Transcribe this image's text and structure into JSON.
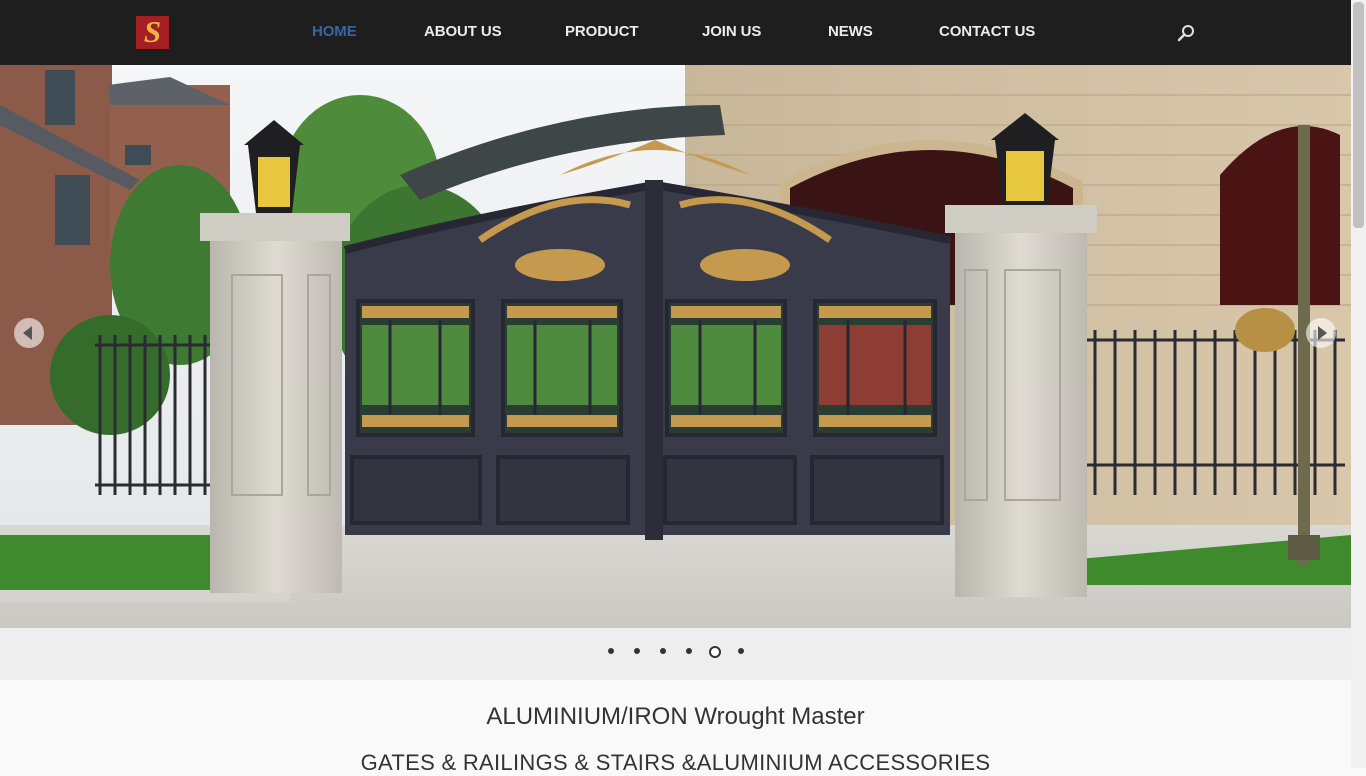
{
  "nav": {
    "logo_letter": "S",
    "items": [
      {
        "label": "HOME",
        "active": true
      },
      {
        "label": "ABOUT US",
        "active": false
      },
      {
        "label": "PRODUCT",
        "active": false
      },
      {
        "label": "JOIN US",
        "active": false
      },
      {
        "label": "NEWS",
        "active": false
      },
      {
        "label": "CONTACT US",
        "active": false
      }
    ],
    "search_icon": "search-icon"
  },
  "slider": {
    "total_slides": 6,
    "active_slide": 5,
    "prev_icon": "arrow-left-icon",
    "next_icon": "arrow-right-icon"
  },
  "content": {
    "title": "ALUMINIUM/IRON Wrought Master",
    "subtitle": "GATES & RAILINGS & STAIRS &ALUMINIUM ACCESSORIES"
  },
  "colors": {
    "navbar": "#1e1e1e",
    "nav_active": "#3a65a5",
    "nav_text": "#ececec",
    "gate": "#3a3b4a",
    "gold": "#c59a4e"
  }
}
